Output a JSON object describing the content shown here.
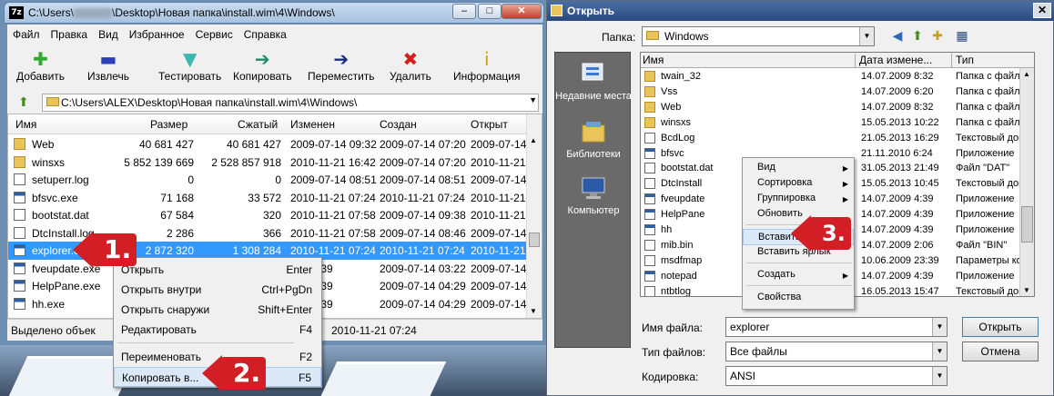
{
  "left_window": {
    "title_prefix": "C:\\Users\\",
    "title_suffix": "\\Desktop\\Новая папка\\install.wim\\4\\Windows\\",
    "app_icon_text": "7z",
    "window_buttons": {
      "minimize": "–",
      "maximize": "□",
      "close": "✕"
    },
    "menu": [
      "Файл",
      "Правка",
      "Вид",
      "Избранное",
      "Сервис",
      "Справка"
    ],
    "toolbar": [
      {
        "label": "Добавить",
        "icon": "add-icon",
        "glyph": "✚",
        "color": "#2eaa2e"
      },
      {
        "label": "Извлечь",
        "icon": "extract-icon",
        "glyph": "▬",
        "color": "#2a3fb8"
      },
      {
        "label": "Тестировать",
        "icon": "test-icon",
        "glyph": "▼",
        "color": "#3cb8b0"
      },
      {
        "label": "Копировать",
        "icon": "copy-icon",
        "glyph": "➔",
        "color": "#1f8a6a"
      },
      {
        "label": "Переместить",
        "icon": "move-icon",
        "glyph": "➔",
        "color": "#1a2a8a"
      },
      {
        "label": "Удалить",
        "icon": "delete-icon",
        "glyph": "✖",
        "color": "#d0201a"
      },
      {
        "label": "Информация",
        "icon": "info-icon",
        "glyph": "i",
        "color": "#c8a020"
      }
    ],
    "address": "C:\\Users\\ALEX\\Desktop\\Новая папка\\install.wim\\4\\Windows\\",
    "columns": [
      "Имя",
      "Размер",
      "Сжатый",
      "Изменен",
      "Создан",
      "Открыт"
    ],
    "rows": [
      {
        "name": "Web",
        "size": "40 681 427",
        "packed": "40 681 427",
        "modified": "2009-07-14 09:32",
        "created": "2009-07-14 07:20",
        "accessed": "2009-07-14 0",
        "type": "folder"
      },
      {
        "name": "winsxs",
        "size": "5 852 139 669",
        "packed": "2 528 857 918",
        "modified": "2010-11-21 16:42",
        "created": "2009-07-14 07:20",
        "accessed": "2010-11-21 1",
        "type": "folder"
      },
      {
        "name": "setuperr.log",
        "size": "0",
        "packed": "0",
        "modified": "2009-07-14 08:51",
        "created": "2009-07-14 08:51",
        "accessed": "2009-07-14 0",
        "type": "file"
      },
      {
        "name": "bfsvc.exe",
        "size": "71 168",
        "packed": "33 572",
        "modified": "2010-11-21 07:24",
        "created": "2010-11-21 07:24",
        "accessed": "2010-11-21 0",
        "type": "exe"
      },
      {
        "name": "bootstat.dat",
        "size": "67 584",
        "packed": "320",
        "modified": "2010-11-21 07:58",
        "created": "2009-07-14 09:38",
        "accessed": "2010-11-21 0",
        "type": "file"
      },
      {
        "name": "DtcInstall.log",
        "size": "2 286",
        "packed": "366",
        "modified": "2010-11-21 07:58",
        "created": "2009-07-14 08:46",
        "accessed": "2009-07-14 0",
        "type": "file"
      },
      {
        "name": "explorer.exe",
        "size": "2 872 320",
        "packed": "1 308 284",
        "modified": "2010-11-21 07:24",
        "created": "2010-11-21 07:24",
        "accessed": "2010-11-21 0",
        "type": "exe"
      },
      {
        "name": "fveupdate.exe",
        "size": "",
        "packed": "",
        "modified": "14 05:39",
        "created": "2009-07-14 03:22",
        "accessed": "2009-07-14 0",
        "type": "exe"
      },
      {
        "name": "HelpPane.exe",
        "size": "",
        "packed": "",
        "modified": "14 05:39",
        "created": "2009-07-14 04:29",
        "accessed": "2009-07-14 0",
        "type": "exe"
      },
      {
        "name": "hh.exe",
        "size": "",
        "packed": "",
        "modified": "14 05:39",
        "created": "2009-07-14 04:29",
        "accessed": "2009-07-14 0",
        "type": "exe"
      }
    ],
    "status_left": "Выделено объек",
    "status_right": "2010-11-21 07:24",
    "context_menu": [
      {
        "label": "Открыть",
        "shortcut": "Enter"
      },
      {
        "label": "Открыть внутри",
        "shortcut": "Ctrl+PgDn"
      },
      {
        "label": "Открыть снаружи",
        "shortcut": "Shift+Enter"
      },
      {
        "label": "Редактировать",
        "shortcut": "F4"
      },
      {
        "label": "Переименовать",
        "shortcut": "F2"
      },
      {
        "label": "Копировать в...",
        "shortcut": "F5"
      }
    ],
    "callout_1": "1.",
    "callout_2": "2."
  },
  "right_window": {
    "title": "Открыть",
    "close": "✕",
    "folder_label": "Папка:",
    "folder_value": "Windows",
    "places": [
      "Недавние места",
      "Библиотеки",
      "Компьютер"
    ],
    "columns": [
      "Имя",
      "Дата измене...",
      "Тип"
    ],
    "rows": [
      {
        "name": "twain_32",
        "date": "14.07.2009 8:32",
        "type": "Папка с файлами",
        "kind": "folder"
      },
      {
        "name": "Vss",
        "date": "14.07.2009 6:20",
        "type": "Папка с файлами",
        "kind": "folder"
      },
      {
        "name": "Web",
        "date": "14.07.2009 8:32",
        "type": "Папка с файлами",
        "kind": "folder"
      },
      {
        "name": "winsxs",
        "date": "15.05.2013 10:22",
        "type": "Папка с файлами",
        "kind": "folder"
      },
      {
        "name": "BcdLog",
        "date": "21.05.2013 16:29",
        "type": "Текстовый док...",
        "kind": "file"
      },
      {
        "name": "bfsvc",
        "date": "21.11.2010 6:24",
        "type": "Приложение",
        "kind": "exe"
      },
      {
        "name": "bootstat.dat",
        "date": "31.05.2013 21:49",
        "type": "Файл \"DAT\"",
        "kind": "file"
      },
      {
        "name": "DtcInstall",
        "date": "15.05.2013 10:45",
        "type": "Текстовый док...",
        "kind": "file"
      },
      {
        "name": "fveupdate",
        "date": "14.07.2009 4:39",
        "type": "Приложение",
        "kind": "exe"
      },
      {
        "name": "HelpPane",
        "date": "14.07.2009 4:39",
        "type": "Приложение",
        "kind": "exe"
      },
      {
        "name": "hh",
        "date": "14.07.2009 4:39",
        "type": "Приложение",
        "kind": "exe"
      },
      {
        "name": "mib.bin",
        "date": "14.07.2009 2:06",
        "type": "Файл \"BIN\"",
        "kind": "file"
      },
      {
        "name": "msdfmap",
        "date": "10.06.2009 23:39",
        "type": "Параметры кон...",
        "kind": "file"
      },
      {
        "name": "notepad",
        "date": "14.07.2009 4:39",
        "type": "Приложение",
        "kind": "exe"
      },
      {
        "name": "ntbtlog",
        "date": "16.05.2013 15:47",
        "type": "Текстовый док...",
        "kind": "file"
      }
    ],
    "context_menu": [
      {
        "label": "Вид",
        "arrow": "▶"
      },
      {
        "label": "Сортировка",
        "arrow": "▶"
      },
      {
        "label": "Группировка",
        "arrow": "▶"
      },
      {
        "label": "Обновить",
        "arrow": ""
      },
      {
        "label": "Вставить",
        "arrow": ""
      },
      {
        "label": "Вставить ярлык",
        "arrow": ""
      },
      {
        "label": "Создать",
        "arrow": "▶"
      },
      {
        "label": "Свойства",
        "arrow": ""
      }
    ],
    "callout_3": "3.",
    "filename_label": "Имя файла:",
    "filename_value": "explorer",
    "filetype_label": "Тип файлов:",
    "filetype_value": "Все файлы",
    "encoding_label": "Кодировка:",
    "encoding_value": "ANSI",
    "open_button": "Открыть",
    "cancel_button": "Отмена"
  }
}
